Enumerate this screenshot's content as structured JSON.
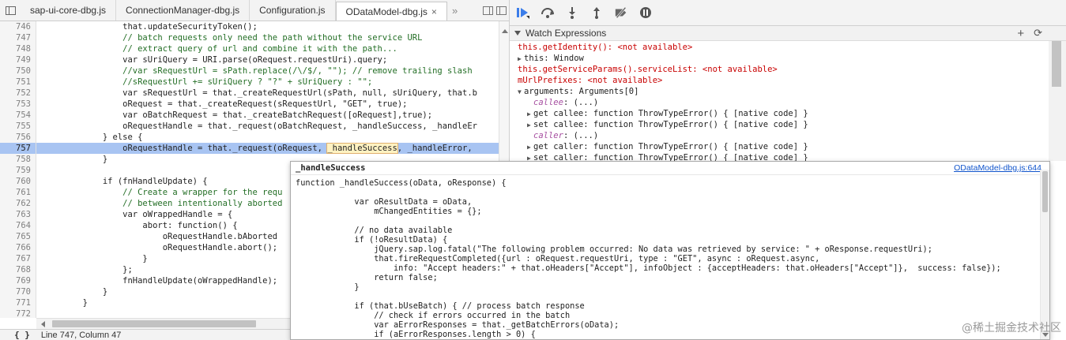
{
  "tabs": [
    {
      "label": "sap-ui-core-dbg.js",
      "active": false
    },
    {
      "label": "ConnectionManager-dbg.js",
      "active": false
    },
    {
      "label": "Configuration.js",
      "active": false
    },
    {
      "label": "ODataModel-dbg.js",
      "active": true
    }
  ],
  "tab_close": "×",
  "tab_more": "»",
  "code_lines": [
    {
      "n": "746",
      "text": "                that.updateSecurityToken();"
    },
    {
      "n": "747",
      "text": "                // batch requests only need the path without the service URL",
      "type": "comment"
    },
    {
      "n": "748",
      "text": "                // extract query of url and combine it with the path...",
      "type": "comment"
    },
    {
      "n": "749",
      "text": "                var sUriQuery = URI.parse(oRequest.requestUri).query;"
    },
    {
      "n": "750",
      "text": "                //var sRequestUrl = sPath.replace(/\\/$/, \"\"); // remove trailing slash",
      "type": "comment"
    },
    {
      "n": "751",
      "text": "                //sRequestUrl += sUriQuery ? \"?\" + sUriQuery : \"\";",
      "type": "comment"
    },
    {
      "n": "752",
      "text": "                var sRequestUrl = that._createRequestUrl(sPath, null, sUriQuery, that.b"
    },
    {
      "n": "753",
      "text": "                oRequest = that._createRequest(sRequestUrl, \"GET\", true);"
    },
    {
      "n": "754",
      "text": "                var oBatchRequest = that._createBatchRequest([oRequest],true);"
    },
    {
      "n": "755",
      "text": "                oRequestHandle = that._request(oBatchRequest, _handleSuccess, _handleEr"
    },
    {
      "n": "756",
      "text": "            } else {"
    },
    {
      "n": "757",
      "text_a": "                oRequestHandle = that._request(oRequest, ",
      "hl": "_handleSuccess",
      "text_b": ", _handleError, ",
      "type": "exec"
    },
    {
      "n": "758",
      "text": "            }"
    },
    {
      "n": "759",
      "text": ""
    },
    {
      "n": "760",
      "text": "            if (fnHandleUpdate) {"
    },
    {
      "n": "761",
      "text": "                // Create a wrapper for the requ",
      "type": "comment"
    },
    {
      "n": "762",
      "text": "                // between intentionally aborted",
      "type": "comment"
    },
    {
      "n": "763",
      "text": "                var oWrappedHandle = {"
    },
    {
      "n": "764",
      "text": "                    abort: function() {"
    },
    {
      "n": "765",
      "text": "                        oRequestHandle.bAborted"
    },
    {
      "n": "766",
      "text": "                        oRequestHandle.abort();"
    },
    {
      "n": "767",
      "text": "                    }"
    },
    {
      "n": "768",
      "text": "                };"
    },
    {
      "n": "769",
      "text": "                fnHandleUpdate(oWrappedHandle);"
    },
    {
      "n": "770",
      "text": "            }"
    },
    {
      "n": "771",
      "text": "        }"
    },
    {
      "n": "772",
      "text": ""
    },
    {
      "n": "773",
      "text": ""
    }
  ],
  "status": {
    "braces": "{ }",
    "position": "Line 747, Column 47"
  },
  "watch": {
    "title": "Watch Expressions",
    "add": "+",
    "refresh": "⟳",
    "items": [
      {
        "kind": "na",
        "name": "this.getIdentity()",
        "value": "<not available>"
      },
      {
        "kind": "obj",
        "name": "this",
        "value": "Window",
        "toggle": "▶"
      },
      {
        "kind": "na",
        "name": "this.getServiceParams().serviceList",
        "value": "<not available>"
      },
      {
        "kind": "na",
        "name": "mUrlPrefixes",
        "value": "<not available>"
      },
      {
        "kind": "obj",
        "name": "arguments",
        "value": "Arguments[0]",
        "toggle": "▼"
      },
      {
        "kind": "prop",
        "name": "callee",
        "value": "(...)",
        "indent": 1
      },
      {
        "kind": "obj",
        "name": "get callee",
        "value": "function ThrowTypeError() { [native code] }",
        "toggle": "▶",
        "indent": 1
      },
      {
        "kind": "obj",
        "name": "set callee",
        "value": "function ThrowTypeError() { [native code] }",
        "toggle": "▶",
        "indent": 1
      },
      {
        "kind": "prop",
        "name": "caller",
        "value": "(...)",
        "indent": 1
      },
      {
        "kind": "obj",
        "name": "get caller",
        "value": "function ThrowTypeError() { [native code] }",
        "toggle": "▶",
        "indent": 1
      },
      {
        "kind": "obj",
        "name": "set caller",
        "value": "function ThrowTypeError() { [native code] }",
        "toggle": "▶",
        "indent": 1
      }
    ]
  },
  "popover": {
    "title": "_handleSuccess",
    "link": "ODataModel-dbg.js:644",
    "lines": [
      "function _handleSuccess(oData, oResponse) {",
      "",
      "            var oResultData = oData,",
      "                mChangedEntities = {};",
      "",
      "            // no data available",
      "            if (!oResultData) {",
      "                jQuery.sap.log.fatal(\"The following problem occurred: No data was retrieved by service: \" + oResponse.requestUri);",
      "                that.fireRequestCompleted({url : oRequest.requestUri, type : \"GET\", async : oRequest.async,",
      "                    info: \"Accept headers:\" + that.oHeaders[\"Accept\"], infoObject : {acceptHeaders: that.oHeaders[\"Accept\"]},  success: false});",
      "                return false;",
      "            }",
      "",
      "            if (that.bUseBatch) { // process batch response",
      "                // check if errors occurred in the batch",
      "                var aErrorResponses = that._getBatchErrors(oData);",
      "                if (aErrorResponses.length > 0) {"
    ]
  },
  "watermark": "@稀土掘金技术社区",
  "colors": {
    "exec_line": "#a8c4f2",
    "breakpoint": "#4d8ae8",
    "resume_blue": "#3b7de9"
  }
}
